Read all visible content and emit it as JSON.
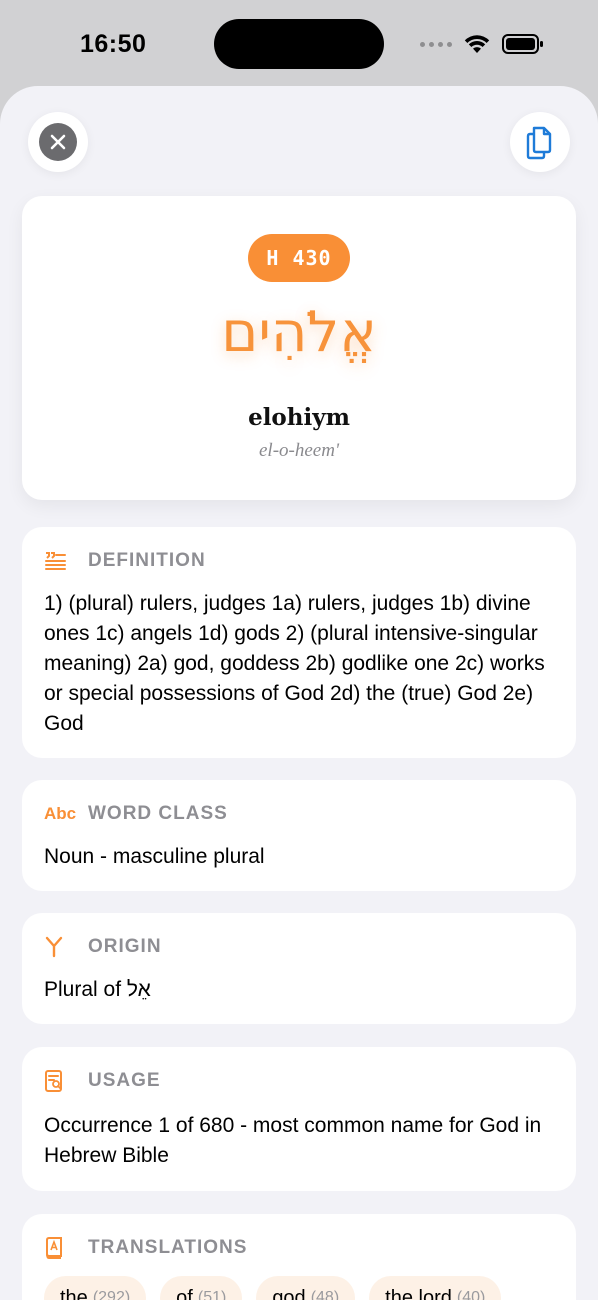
{
  "status": {
    "time": "16:50"
  },
  "entry": {
    "strongs": "H 430",
    "hebrew": "אֱלֹהִים",
    "transliteration": "elohiym",
    "pronunciation": "el-o-heem'"
  },
  "definition": {
    "title": "DEFINITION",
    "text": "1) (plural) rulers, judges 1a) rulers, judges 1b) divine ones 1c) angels 1d) gods 2) (plural intensive-singular meaning) 2a) god, goddess 2b) godlike one 2c) works or special possessions of God 2d) the (true) God 2e) God"
  },
  "word_class": {
    "icon_text": "Abc",
    "title": "WORD CLASS",
    "text": "Noun - masculine plural"
  },
  "origin": {
    "title": "ORIGIN",
    "text": "Plural of אֵל"
  },
  "usage": {
    "title": "USAGE",
    "text": "Occurrence 1 of 680 - most common name for God in Hebrew Bible"
  },
  "translations": {
    "title": "TRANSLATIONS",
    "items": [
      {
        "word": "the",
        "count": "(292)"
      },
      {
        "word": "of",
        "count": "(51)"
      },
      {
        "word": "god",
        "count": "(48)"
      },
      {
        "word": "the lord",
        "count": "(40)"
      }
    ]
  },
  "colors": {
    "accent": "#f98f36",
    "background": "#f2f2f7",
    "label": "#8e8e93"
  }
}
